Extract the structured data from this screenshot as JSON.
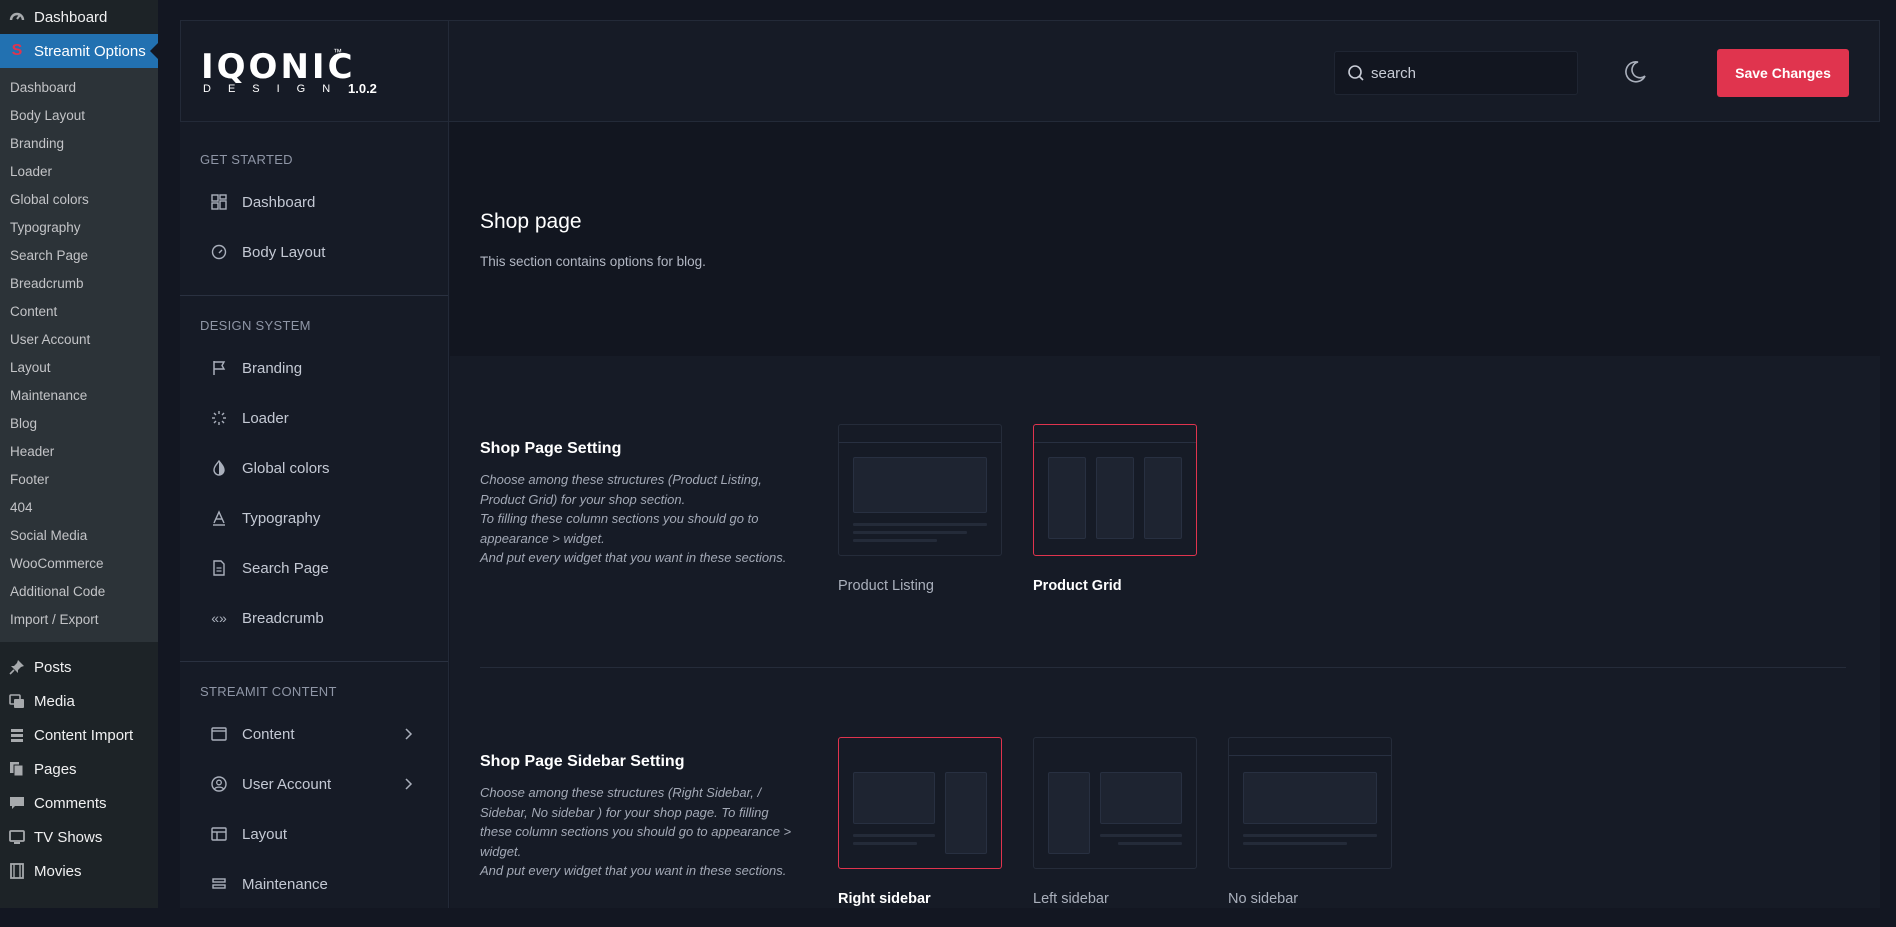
{
  "wp_menu": {
    "dashboard": "Dashboard",
    "streamit_options": "Streamit Options",
    "submenu": [
      "Dashboard",
      "Body Layout",
      "Branding",
      "Loader",
      "Global colors",
      "Typography",
      "Search Page",
      "Breadcrumb",
      "Content",
      "User Account",
      "Layout",
      "Maintenance",
      "Blog",
      "Header",
      "Footer",
      "404",
      "Social Media",
      "WooCommerce",
      "Additional Code",
      "Import / Export"
    ],
    "lower": [
      {
        "label": "Posts",
        "icon": "pin-icon"
      },
      {
        "label": "Media",
        "icon": "media-icon"
      },
      {
        "label": "Content Import",
        "icon": "import-icon"
      },
      {
        "label": "Pages",
        "icon": "pages-icon"
      },
      {
        "label": "Comments",
        "icon": "comments-icon"
      },
      {
        "label": "TV Shows",
        "icon": "tv-icon"
      },
      {
        "label": "Movies",
        "icon": "film-icon"
      }
    ]
  },
  "header": {
    "logo_text": "IQONIC",
    "logo_tm": "™",
    "logo_sub": "DESIGN",
    "version": "1.0.2",
    "search_placeholder": "search",
    "save_label": "Save Changes"
  },
  "options_nav": {
    "groups": [
      {
        "heading": "GET STARTED",
        "items": [
          {
            "label": "Dashboard"
          },
          {
            "label": "Body Layout"
          }
        ]
      },
      {
        "heading": "DESIGN SYSTEM",
        "items": [
          {
            "label": "Branding"
          },
          {
            "label": "Loader"
          },
          {
            "label": "Global colors"
          },
          {
            "label": "Typography"
          },
          {
            "label": "Search Page"
          },
          {
            "label": "Breadcrumb"
          }
        ]
      },
      {
        "heading": "STREAMIT CONTENT",
        "items": [
          {
            "label": "Content"
          },
          {
            "label": "User Account"
          },
          {
            "label": "Layout"
          },
          {
            "label": "Maintenance"
          }
        ]
      }
    ]
  },
  "page": {
    "title": "Shop page",
    "description": "This section contains options for blog."
  },
  "sections": [
    {
      "title": "Shop Page Setting",
      "description_lines": [
        "Choose among these structures (Product Listing, Product Grid) for your shop section.",
        "To filling these column sections you should go to appearance > widget.",
        "And put every widget that you want in these sections."
      ],
      "options": [
        {
          "label": "Product Listing",
          "selected": false
        },
        {
          "label": "Product Grid",
          "selected": true
        }
      ]
    },
    {
      "title": "Shop Page Sidebar Setting",
      "description_lines": [
        "Choose among these structures (Right Sidebar, / Sidebar, No sidebar ) for your shop page. To filling these column sections you should go to appearance > widget.",
        "And put every widget that you want in these sections."
      ],
      "options": [
        {
          "label": "Right sidebar",
          "selected": true
        },
        {
          "label": "Left sidebar",
          "selected": false
        },
        {
          "label": "No sidebar",
          "selected": false
        }
      ]
    }
  ],
  "colors": {
    "accent": "#e0344e",
    "wp_active": "#2271b1",
    "background": "#161b26"
  }
}
